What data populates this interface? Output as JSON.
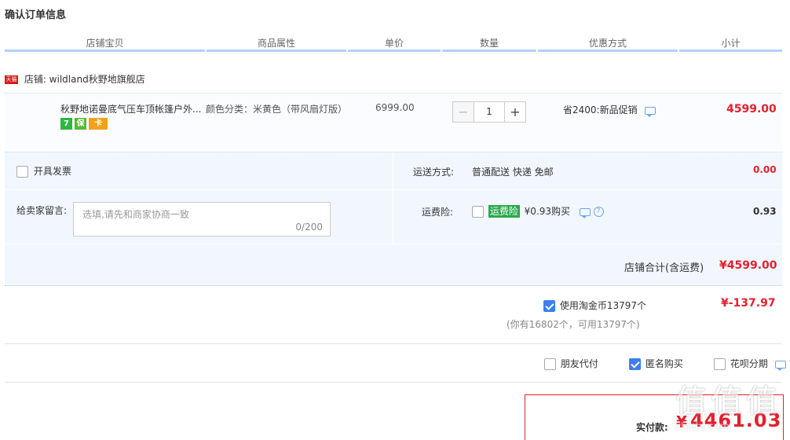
{
  "page_title": "确认订单信息",
  "columns": [
    "店铺宝贝",
    "商品属性",
    "单价",
    "数量",
    "优惠方式",
    "小计"
  ],
  "shop": {
    "badge": "天猫",
    "label": "店铺: wildland秋野地旗舰店"
  },
  "item": {
    "name": "秋野地诺曼底气压车顶帐篷户外...",
    "tags": [
      "7",
      "保",
      "卡"
    ],
    "attr": "颜色分类：米黄色（带风扇灯版）",
    "unit_price": "6999.00",
    "quantity": "1",
    "qty_minus": "−",
    "qty_plus": "+",
    "discount": "省2400:新品促销",
    "subtotal": "4599.00"
  },
  "invoice": {
    "label": "开具发票"
  },
  "shipping": {
    "label": "运送方式:",
    "value": "普通配送 快递 免邮",
    "price": "0.00"
  },
  "memo": {
    "label": "给卖家留言:",
    "placeholder": "选填,请先和商家协商一致",
    "counter": "0/200"
  },
  "insurance": {
    "label": "运费险:",
    "badge": "运费险",
    "text": "¥0.93购买",
    "price": "0.93"
  },
  "shop_total": {
    "label": "店铺合计(含运费)",
    "value": "¥4599.00"
  },
  "coins": {
    "label": "使用淘金币13797个",
    "value": "¥-137.97",
    "note": "(你有16802个，可用13797个)"
  },
  "options": {
    "friend_pay": "朋友代付",
    "anonymous": "匿名购买",
    "huabei": "花呗分期"
  },
  "payment": {
    "label": "实付款:",
    "value": "4461.03",
    "currency": "¥"
  },
  "watermark": "值",
  "watermark_url": "zhizhi.com"
}
